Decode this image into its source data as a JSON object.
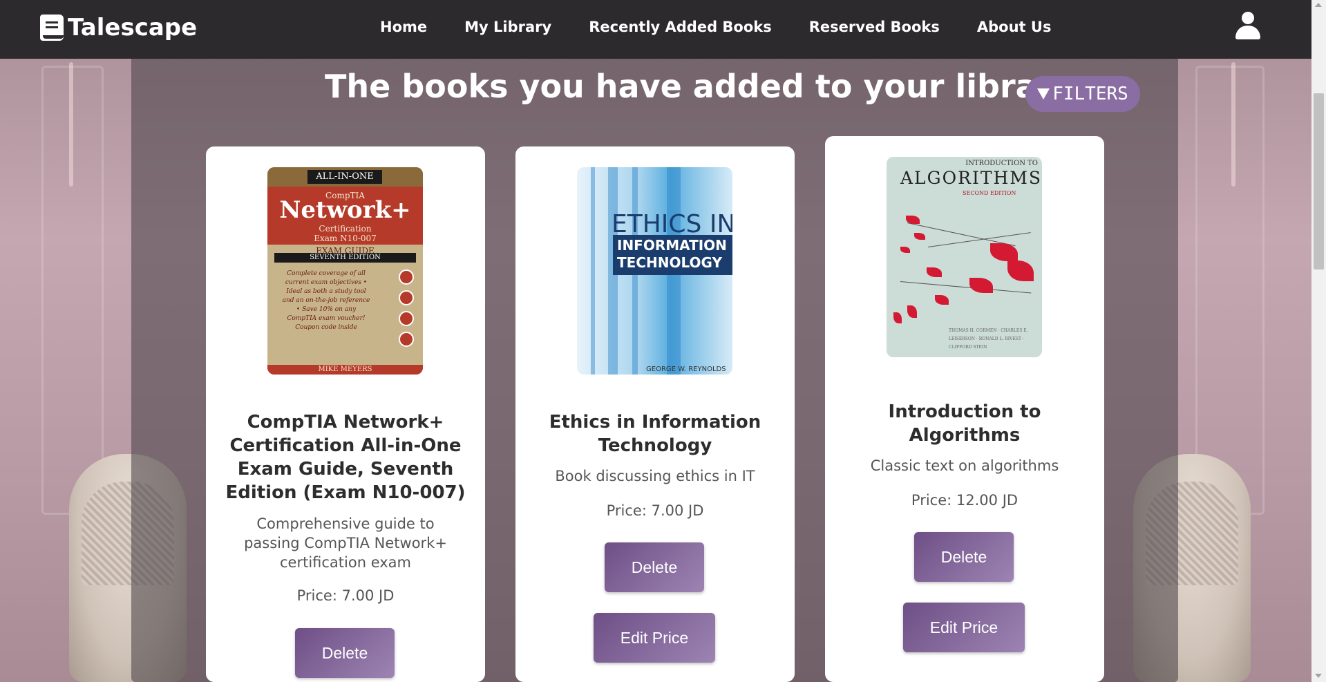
{
  "app": {
    "brand_name": "Talescape"
  },
  "nav": {
    "items": [
      {
        "label": "Home"
      },
      {
        "label": "My Library"
      },
      {
        "label": "Recently Added Books"
      },
      {
        "label": "Reserved Books"
      },
      {
        "label": "About Us"
      }
    ]
  },
  "page": {
    "title": "The books you have added to your library",
    "filters_label": "FILTERS"
  },
  "colors": {
    "navbar": "#2c2a2c",
    "accent": "#8a6ea3",
    "button_gradient_start": "#6e4f86",
    "button_gradient_end": "#9d84b3"
  },
  "books": [
    {
      "title": "CompTIA Network+ Certification All-in-One Exam Guide, Seventh Edition (Exam N10-007)",
      "description": "Comprehensive guide to passing CompTIA Network+ certification exam",
      "price": "Price: 7.00 JD",
      "delete_label": "Delete",
      "cover": {
        "series": "ALL-IN-ONE",
        "brand": "CompTIA",
        "headline": "Network+",
        "subtitle": "Certification Exam N10-007",
        "exam_guide": "EXAM GUIDE",
        "edition": "SEVENTH EDITION",
        "blurb": "Complete coverage of all current exam objectives • Ideal as both a study tool and an on-the-job reference • Save 10% on any CompTIA exam voucher! Coupon code inside",
        "author": "MIKE MEYERS"
      }
    },
    {
      "title": "Ethics in Information Technology",
      "description": "Book discussing ethics in IT",
      "price": "Price: 7.00 JD",
      "delete_label": "Delete",
      "edit_label": "Edit Price",
      "cover": {
        "line1": "ETHICS IN",
        "line2": "INFORMATION",
        "line3": "TECHNOLOGY",
        "author": "GEORGE W. REYNOLDS"
      }
    },
    {
      "title": "Introduction to Algorithms",
      "description": "Classic text on algorithms",
      "price": "Price: 12.00 JD",
      "delete_label": "Delete",
      "edit_label": "Edit Price",
      "cover": {
        "intro": "INTRODUCTION TO",
        "headline": "ALGORITHMS",
        "edition": "SECOND EDITION",
        "authors": "THOMAS H. CORMEN · CHARLES E. LEISERSON · RONALD L. RIVEST · CLIFFORD STEIN"
      }
    }
  ]
}
